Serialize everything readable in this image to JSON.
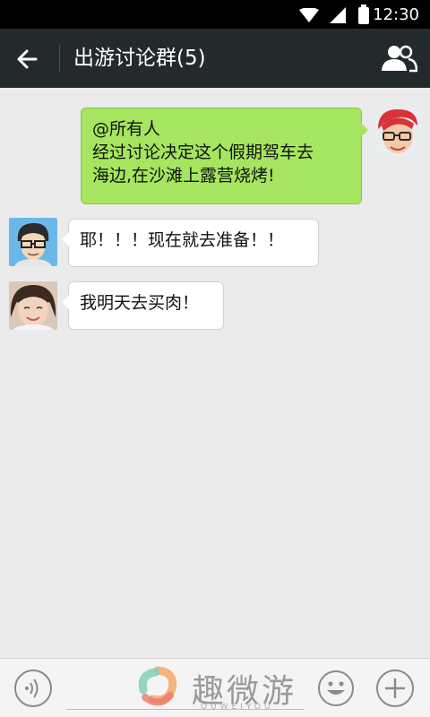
{
  "status_bar": {
    "time": "12:30"
  },
  "header": {
    "title": "出游讨论群(5)",
    "back_icon": "arrow-left-icon",
    "members_icon": "group-members-icon"
  },
  "messages": [
    {
      "direction": "out",
      "line1": "@所有人",
      "line2": "经过讨论决定这个假期驾车去",
      "line3": "海边,在沙滩上露营烧烤!"
    },
    {
      "direction": "in",
      "text": "耶！！！现在就去准备！！"
    },
    {
      "direction": "in",
      "text": "我明天去买肉！"
    }
  ],
  "input_bar": {
    "voice_icon": "voice-icon",
    "emoji_icon": "smiley-icon",
    "plus_icon": "plus-icon"
  },
  "watermark": {
    "name": "趣微游",
    "sub": "QUWEIYOU"
  },
  "colors": {
    "titlebar": "#24292c",
    "bubble_out": "#a6e55f",
    "bubble_in": "#ffffff",
    "chat_bg": "#ebebeb"
  }
}
